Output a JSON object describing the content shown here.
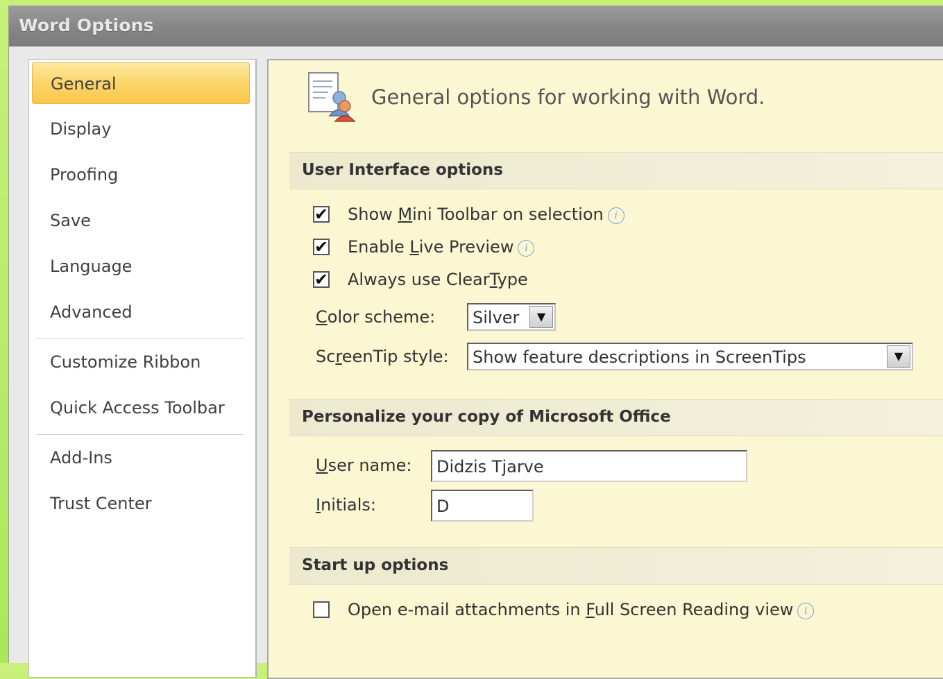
{
  "window": {
    "title": "Word Options"
  },
  "nav": {
    "items": [
      {
        "label": "General"
      },
      {
        "label": "Display"
      },
      {
        "label": "Proofing"
      },
      {
        "label": "Save"
      },
      {
        "label": "Language"
      },
      {
        "label": "Advanced"
      },
      {
        "label": "Customize Ribbon"
      },
      {
        "label": "Quick Access Toolbar"
      },
      {
        "label": "Add-Ins"
      },
      {
        "label": "Trust Center"
      }
    ],
    "selected": "General"
  },
  "content": {
    "header": "General options for working with Word.",
    "ui_section": {
      "title": "User Interface options",
      "checkboxes": [
        {
          "label_pre": "Show ",
          "label_key": "M",
          "label_post": "ini Toolbar on selection",
          "checked": true,
          "info": true
        },
        {
          "label_pre": "Enable ",
          "label_key": "L",
          "label_post": "ive Preview",
          "checked": true,
          "info": true
        },
        {
          "label_pre": "Always use Clear",
          "label_key": "T",
          "label_post": "ype",
          "checked": true,
          "info": false
        }
      ],
      "color_scheme": {
        "label_key": "C",
        "label_post": "olor scheme:",
        "value": "Silver"
      },
      "screentip": {
        "label_pre": "Sc",
        "label_key": "r",
        "label_post": "eenTip style:",
        "value": "Show feature descriptions in ScreenTips"
      }
    },
    "personalize_section": {
      "title": "Personalize your copy of Microsoft Office",
      "user_name": {
        "label_key": "U",
        "label_post": "ser name:",
        "value": "Didzis Tjarve"
      },
      "initials": {
        "label_key": "I",
        "label_post": "nitials:",
        "value": "D"
      }
    },
    "startup_section": {
      "title": "Start up options",
      "checkbox": {
        "label_pre": "Open e-mail attachments in ",
        "label_key": "F",
        "label_post": "ull Screen Reading view",
        "checked": false,
        "info": true
      }
    }
  },
  "icons": {
    "doc": "general-options-icon",
    "info": "info-icon",
    "dropdown": "dropdown-arrow-icon",
    "check_mark": "✔",
    "arrow_glyph": "▼",
    "info_glyph": "i"
  },
  "colors": {
    "selected_nav": "#fcd46a",
    "content_bg": "#fbf7d2",
    "titlebar": "#868686"
  }
}
